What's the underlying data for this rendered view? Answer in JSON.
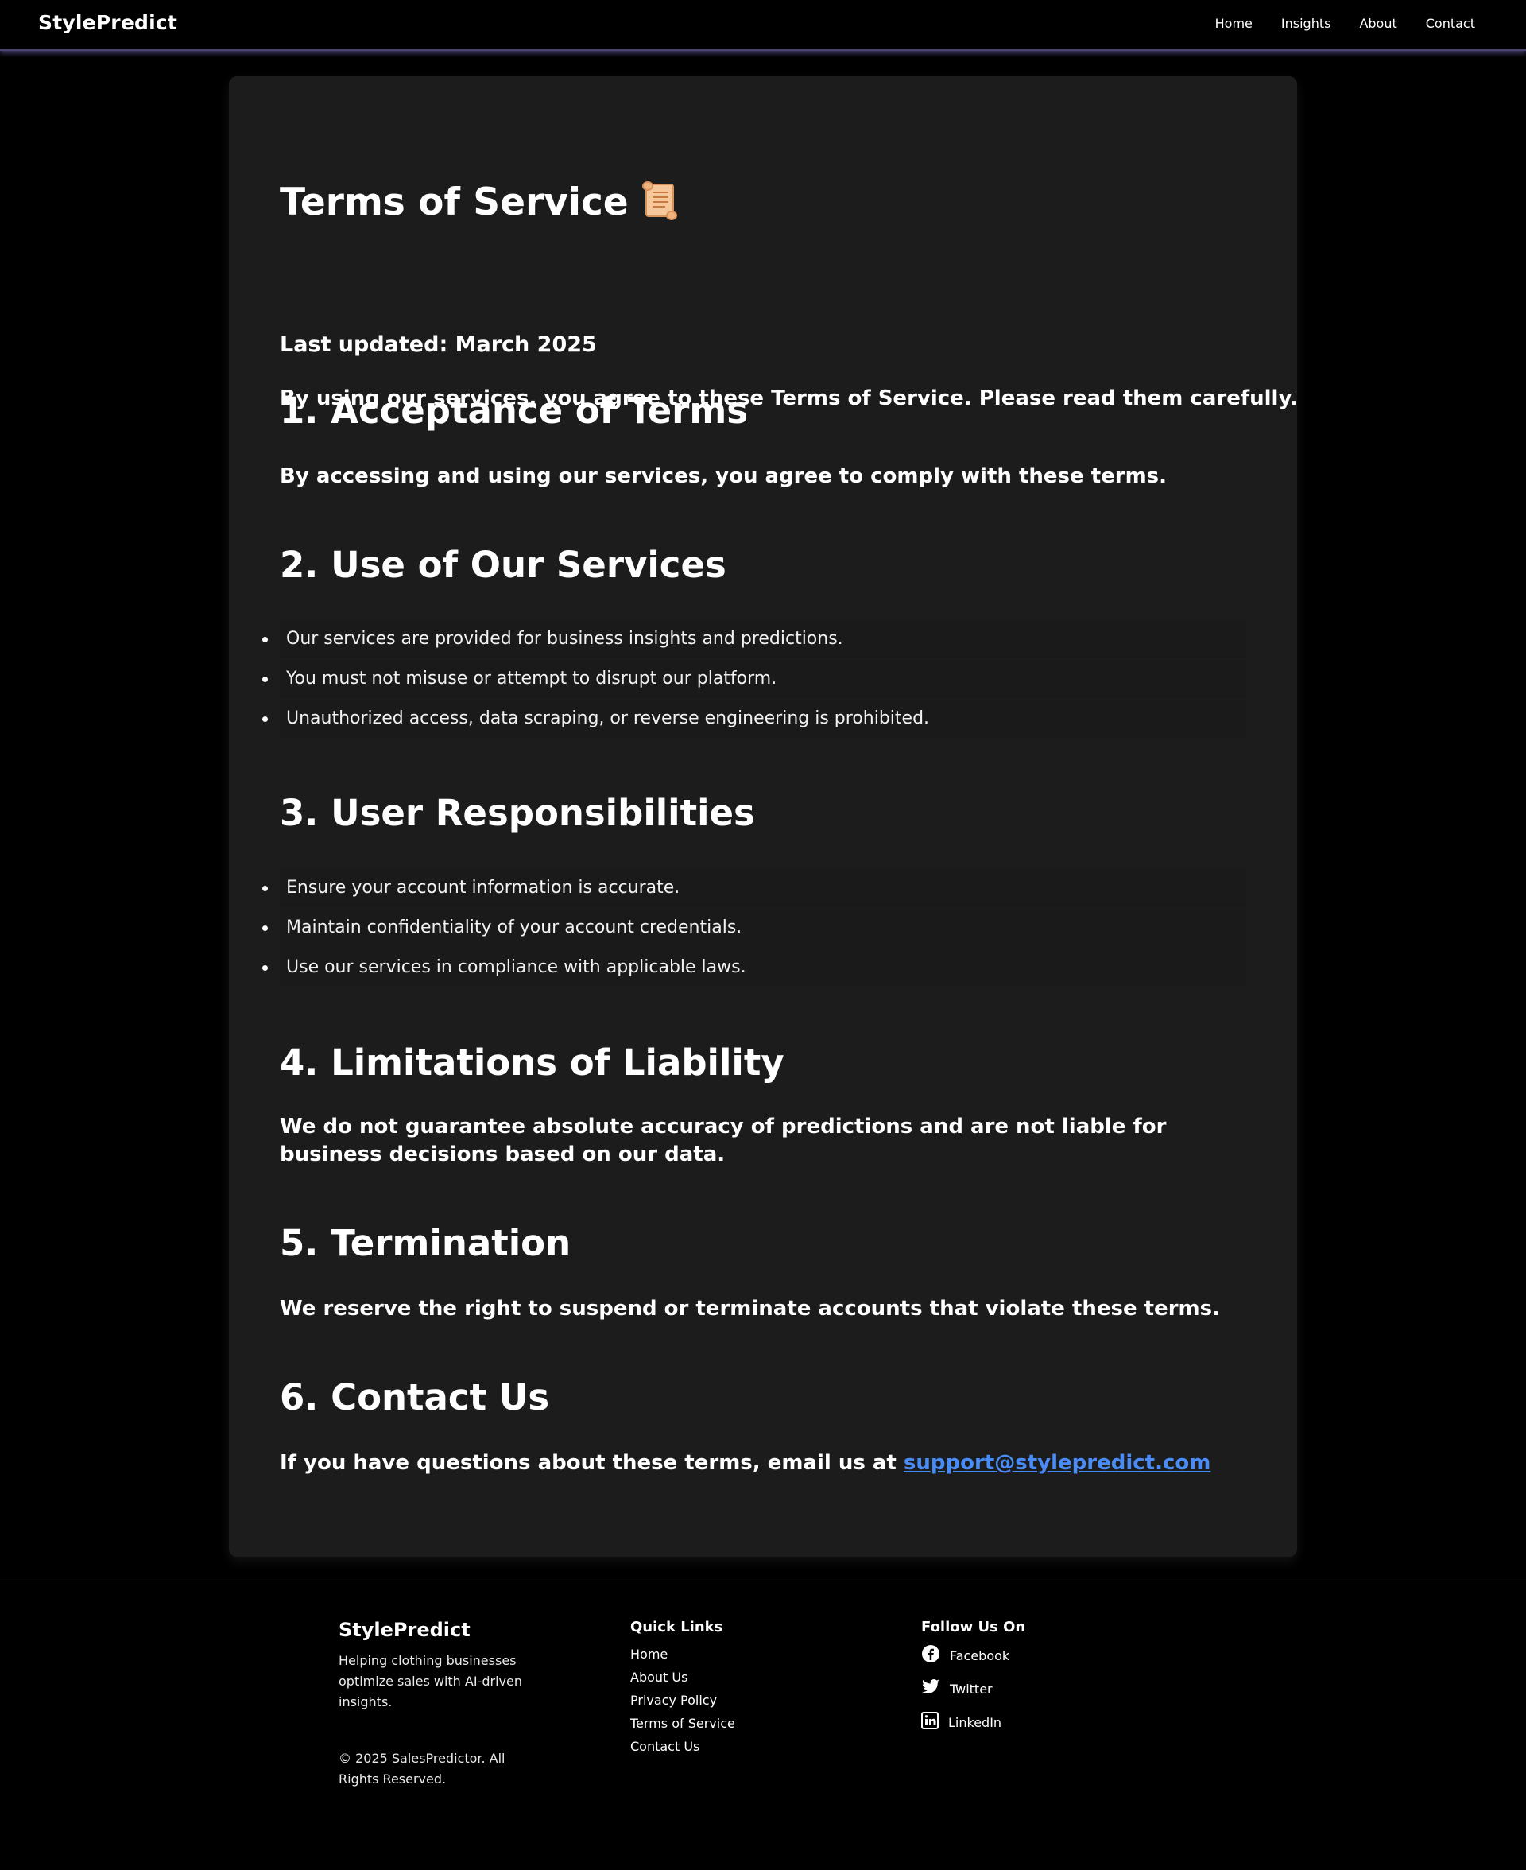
{
  "nav": {
    "brand": "StylePredict",
    "links": [
      "Home",
      "Insights",
      "About",
      "Contact"
    ]
  },
  "page": {
    "title": "Terms of Service",
    "title_icon": "scroll-icon",
    "last_updated": "Last updated: March 2025",
    "intro": "By using our services, you agree to these Terms of Service. Please read them carefully.",
    "sections": [
      {
        "heading": "1. Acceptance of Terms",
        "text": "By accessing and using our services, you agree to comply with these terms."
      },
      {
        "heading": "2. Use of Our Services",
        "items": [
          "Our services are provided for business insights and predictions.",
          "You must not misuse or attempt to disrupt our platform.",
          "Unauthorized access, data scraping, or reverse engineering is prohibited."
        ]
      },
      {
        "heading": "3. User Responsibilities",
        "items": [
          "Ensure your account information is accurate.",
          "Maintain confidentiality of your account credentials.",
          "Use our services in compliance with applicable laws."
        ]
      },
      {
        "heading": "4. Limitations of Liability",
        "text": "We do not guarantee absolute accuracy of predictions and are not liable for business decisions based on our data."
      },
      {
        "heading": "5. Termination",
        "text": "We reserve the right to suspend or terminate accounts that violate these terms."
      },
      {
        "heading": "6. Contact Us",
        "text": "If you have questions about these terms, email us at",
        "email": "support@stylepredict.com"
      }
    ]
  },
  "footer": {
    "brand": "StylePredict",
    "tagline": "Helping clothing businesses optimize sales with AI-driven insights.",
    "copyright": "© 2025 SalesPredictor. All Rights Reserved.",
    "quick_links_heading": "Quick Links",
    "quick_links": [
      "Home",
      "About Us",
      "Privacy Policy",
      "Terms of Service",
      "Contact Us"
    ],
    "follow_heading": "Follow Us On",
    "social": [
      {
        "label": "Facebook",
        "icon": "facebook-icon"
      },
      {
        "label": "Twitter",
        "icon": "twitter-icon"
      },
      {
        "label": "LinkedIn",
        "icon": "linkedin-icon"
      }
    ]
  },
  "colors": {
    "background": "#000000",
    "card": "#1c1c1d",
    "list_item": "#1a1a1a",
    "link": "#4a8cf5",
    "nav_glow": "#7a6ebe"
  }
}
